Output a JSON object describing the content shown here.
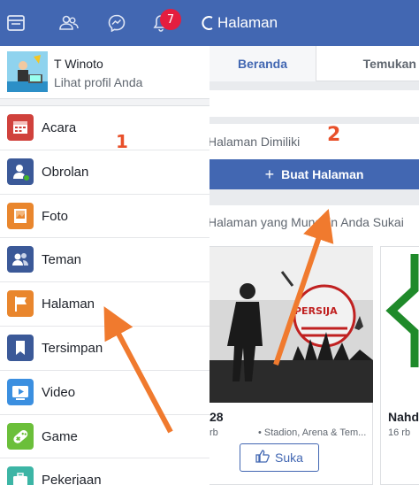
{
  "topbar": {
    "notification_count": "7",
    "right_title": "Halaman",
    "icons": [
      "feed-icon",
      "friends-icon",
      "messenger-icon",
      "bell-icon",
      "search-icon"
    ]
  },
  "drawer": {
    "profile": {
      "name": "T Winoto",
      "subtitle": "Lihat profil Anda"
    },
    "items": [
      {
        "label": "Acara",
        "icon": "calendar-icon",
        "color": "#d0413c"
      },
      {
        "label": "Obrolan",
        "icon": "chat-person-icon",
        "color": "#3b5998"
      },
      {
        "label": "Foto",
        "icon": "photo-icon",
        "color": "#e9862d"
      },
      {
        "label": "Teman",
        "icon": "friends-icon",
        "color": "#3b5998"
      },
      {
        "label": "Halaman",
        "icon": "flag-icon",
        "color": "#e9862d"
      },
      {
        "label": "Tersimpan",
        "icon": "bookmark-icon",
        "color": "#3b5998"
      },
      {
        "label": "Video",
        "icon": "video-icon",
        "color": "#3b8fe0"
      },
      {
        "label": "Game",
        "icon": "game-icon",
        "color": "#6bbf3a"
      },
      {
        "label": "Pekerjaan",
        "icon": "briefcase-icon",
        "color": "#3cb5a5"
      }
    ]
  },
  "content": {
    "tabs": [
      "Beranda",
      "Temukan"
    ],
    "owned_title": "Halaman Dimiliki",
    "create_button": "Buat Halaman",
    "liked_title": "Halaman yang Mungkin Anda Sukai",
    "cards": [
      {
        "name": "28",
        "likes": "rb",
        "category": "• Stadion, Arena & Tem...",
        "like_label": "Suka",
        "photo_text": "PERSIJA"
      },
      {
        "name": "Nahdl",
        "likes": "16 rb"
      }
    ]
  },
  "annotations": {
    "step1": "1",
    "step2": "2"
  },
  "colors": {
    "brand": "#4267b2",
    "arrow": "#f07a2e",
    "badge": "#e41e3f"
  }
}
